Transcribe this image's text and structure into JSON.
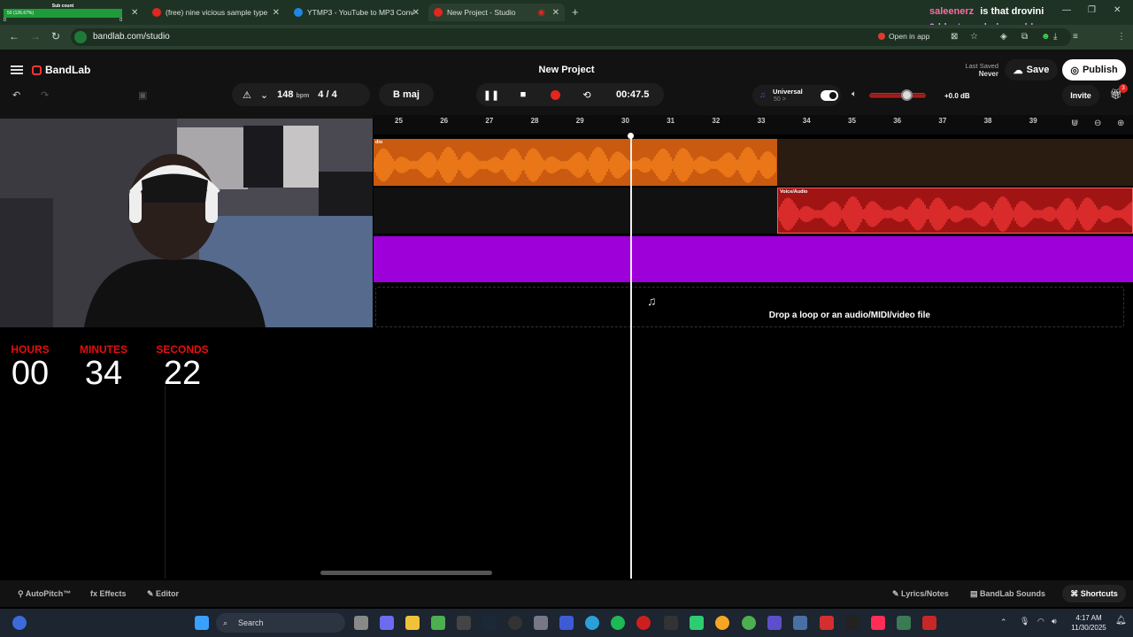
{
  "browser": {
    "sub_widget": {
      "title": "Sub count",
      "bar": "50 (126.67%)",
      "left": "0",
      "right": "0"
    },
    "tabs": [
      {
        "label": "(free) nine vicious sample type",
        "fav_color": "#e3261f"
      },
      {
        "label": "YTMP3 - YouTube to MP3 Conv",
        "fav_color": "#1e88e5"
      },
      {
        "label": "New Project - Studio",
        "fav_color": "#e3261f"
      }
    ],
    "url": "bandlab.com/studio",
    "open_in_app": "Open in app",
    "chat": {
      "user": "saleenerz",
      "message": "is that drovini",
      "user2": "0dd_streamhub_world"
    },
    "avatar": "T"
  },
  "studio": {
    "brand": "BandLab",
    "project_title": "New Project",
    "last_saved_label": "Last Saved",
    "last_saved_value": "Never",
    "save": "Save",
    "publish": "Publish",
    "bpm_value": "148",
    "bpm_unit": "bpm",
    "time_sig_num": "4",
    "time_sig_sep": "/",
    "time_sig_den": "4",
    "key": "B maj",
    "time": "00:47.5",
    "universal_label": "Universal",
    "universal_sub": "50 >",
    "db": "+0.0 dB",
    "invite": "Invite",
    "gift_badge": "3",
    "ruler": [
      "25",
      "26",
      "27",
      "28",
      "29",
      "30",
      "31",
      "32",
      "33",
      "34",
      "35",
      "36",
      "37",
      "38",
      "39"
    ],
    "clip1_label": "dio",
    "clip2_label": "Voice/Audio",
    "drop_text": "Drop a loop or an audio/MIDI/video file"
  },
  "timer": {
    "hours_label": "HOURS",
    "hours": "00",
    "minutes_label": "MINUTES",
    "minutes": "34",
    "seconds_label": "SECONDS",
    "seconds": "22"
  },
  "footer": {
    "autopitch": "AutoPitch™",
    "effects": "Effects",
    "editor": "Editor",
    "lyrics": "Lyrics/Notes",
    "sounds": "BandLab Sounds",
    "shortcuts": "Shortcuts"
  },
  "taskbar": {
    "search": "Search",
    "time": "4:17 AM",
    "date": "11/30/2025"
  }
}
